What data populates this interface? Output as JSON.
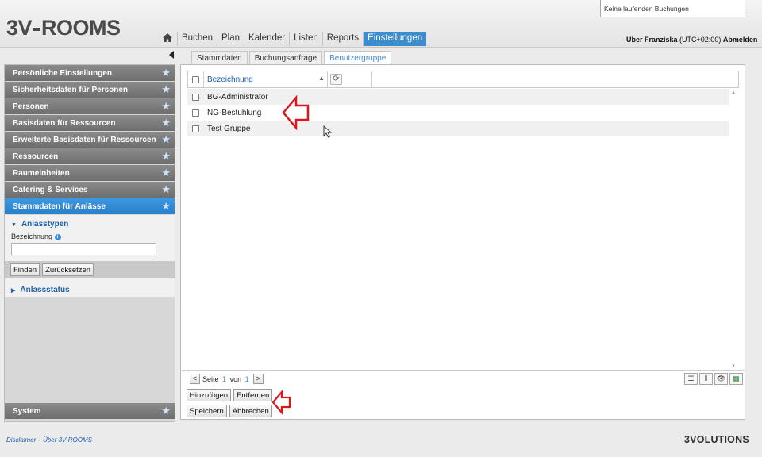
{
  "header": {
    "logo": {
      "prefix": "3V",
      "suffix": "ROOMS"
    },
    "notice": "Keine laufenden Buchungen",
    "nav": [
      {
        "label": "Buchen"
      },
      {
        "label": "Plan"
      },
      {
        "label": "Kalender"
      },
      {
        "label": "Listen"
      },
      {
        "label": "Reports"
      },
      {
        "label": "Einstellungen",
        "active": true
      }
    ],
    "user": {
      "name": "Uber Franziska",
      "tz": "(UTC+02:00)",
      "logout": "Abmelden"
    }
  },
  "sidebar": {
    "items": [
      {
        "label": "Persönliche Einstellungen"
      },
      {
        "label": "Sicherheitsdaten für Personen"
      },
      {
        "label": "Personen"
      },
      {
        "label": "Basisdaten für Ressourcen"
      },
      {
        "label": "Erweiterte Basisdaten für Ressourcen"
      },
      {
        "label": "Ressourcen"
      },
      {
        "label": "Raumeinheiten"
      },
      {
        "label": "Catering & Services"
      },
      {
        "label": "Stammdaten für Anlässe",
        "active": true
      }
    ],
    "panel": {
      "section1": "Anlasstypen",
      "field_label": "Bezeichnung",
      "field_value": "",
      "find_button": "Finden",
      "reset_button": "Zurücksetzen",
      "section2": "Anlassstatus"
    },
    "bottom_item": "System"
  },
  "subtabs": [
    {
      "label": "Stammdaten"
    },
    {
      "label": "Buchungsanfrage"
    },
    {
      "label": "Benutzergruppe",
      "active": true
    }
  ],
  "grid": {
    "column_header": "Bezeichnung",
    "rows": [
      "BG-Administrator",
      "NG-Bestuhlung",
      "Test Gruppe"
    ]
  },
  "pager": {
    "page_word": "Seite",
    "current": "1",
    "of_word": "von",
    "total": "1"
  },
  "actions": {
    "add": "Hinzufügen",
    "remove": "Entfernen",
    "save": "Speichern",
    "cancel": "Abbrechen"
  },
  "footer": {
    "disclaimer": "Disclaimer",
    "about": "Über 3V-ROOMS",
    "brand": "3VOLUTIONS"
  },
  "colors": {
    "accent": "#3b8dd0",
    "sidebar_item": "#7c7c7c",
    "annotation_arrow": "#e0141b"
  }
}
